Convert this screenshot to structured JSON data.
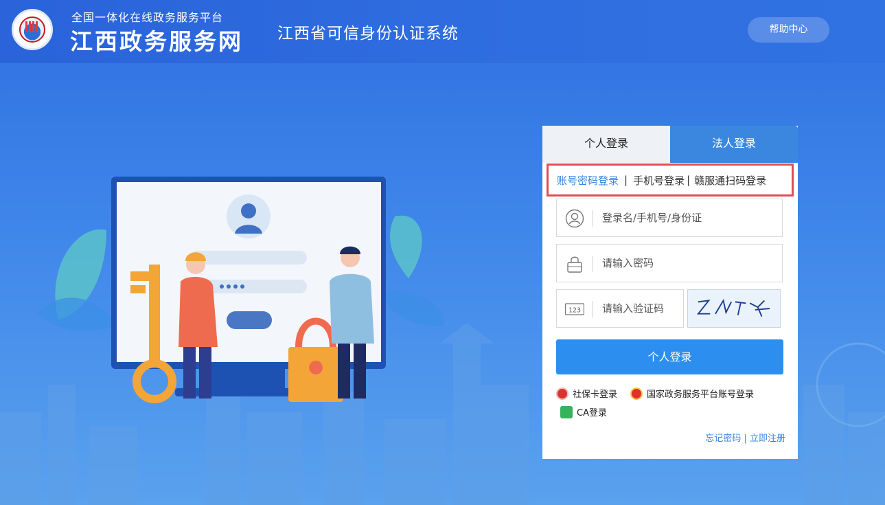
{
  "header": {
    "brand_subtitle": "全国一体化在线政务服务平台",
    "brand_title": "江西政务服务网",
    "system_title": "江西省可信身份认证系统",
    "help_label": "帮助中心"
  },
  "login": {
    "tabs": [
      {
        "label": "个人登录",
        "active": true
      },
      {
        "label": "法人登录",
        "active": false
      }
    ],
    "modes": {
      "account": "账号密码登录",
      "sep1": "|",
      "phone": "手机号登录",
      "sep2": "|",
      "scan": "赣服通扫码登录"
    },
    "username_placeholder": "登录名/手机号/身份证",
    "password_placeholder": "请输入密码",
    "code_placeholder": "请输入验证码",
    "code_icon_text": "123",
    "submit_label": "个人登录",
    "alt_logins": {
      "social_card": "社保卡登录",
      "national": "国家政务服务平台账号登录",
      "ca": "CA登录"
    },
    "forgot": "忘记密码",
    "link_sep": "|",
    "register": "立即注册"
  },
  "colors": {
    "primary": "#2c8ff0",
    "tab_active_blue": "#3b87df",
    "highlight_red": "#e14c52"
  }
}
